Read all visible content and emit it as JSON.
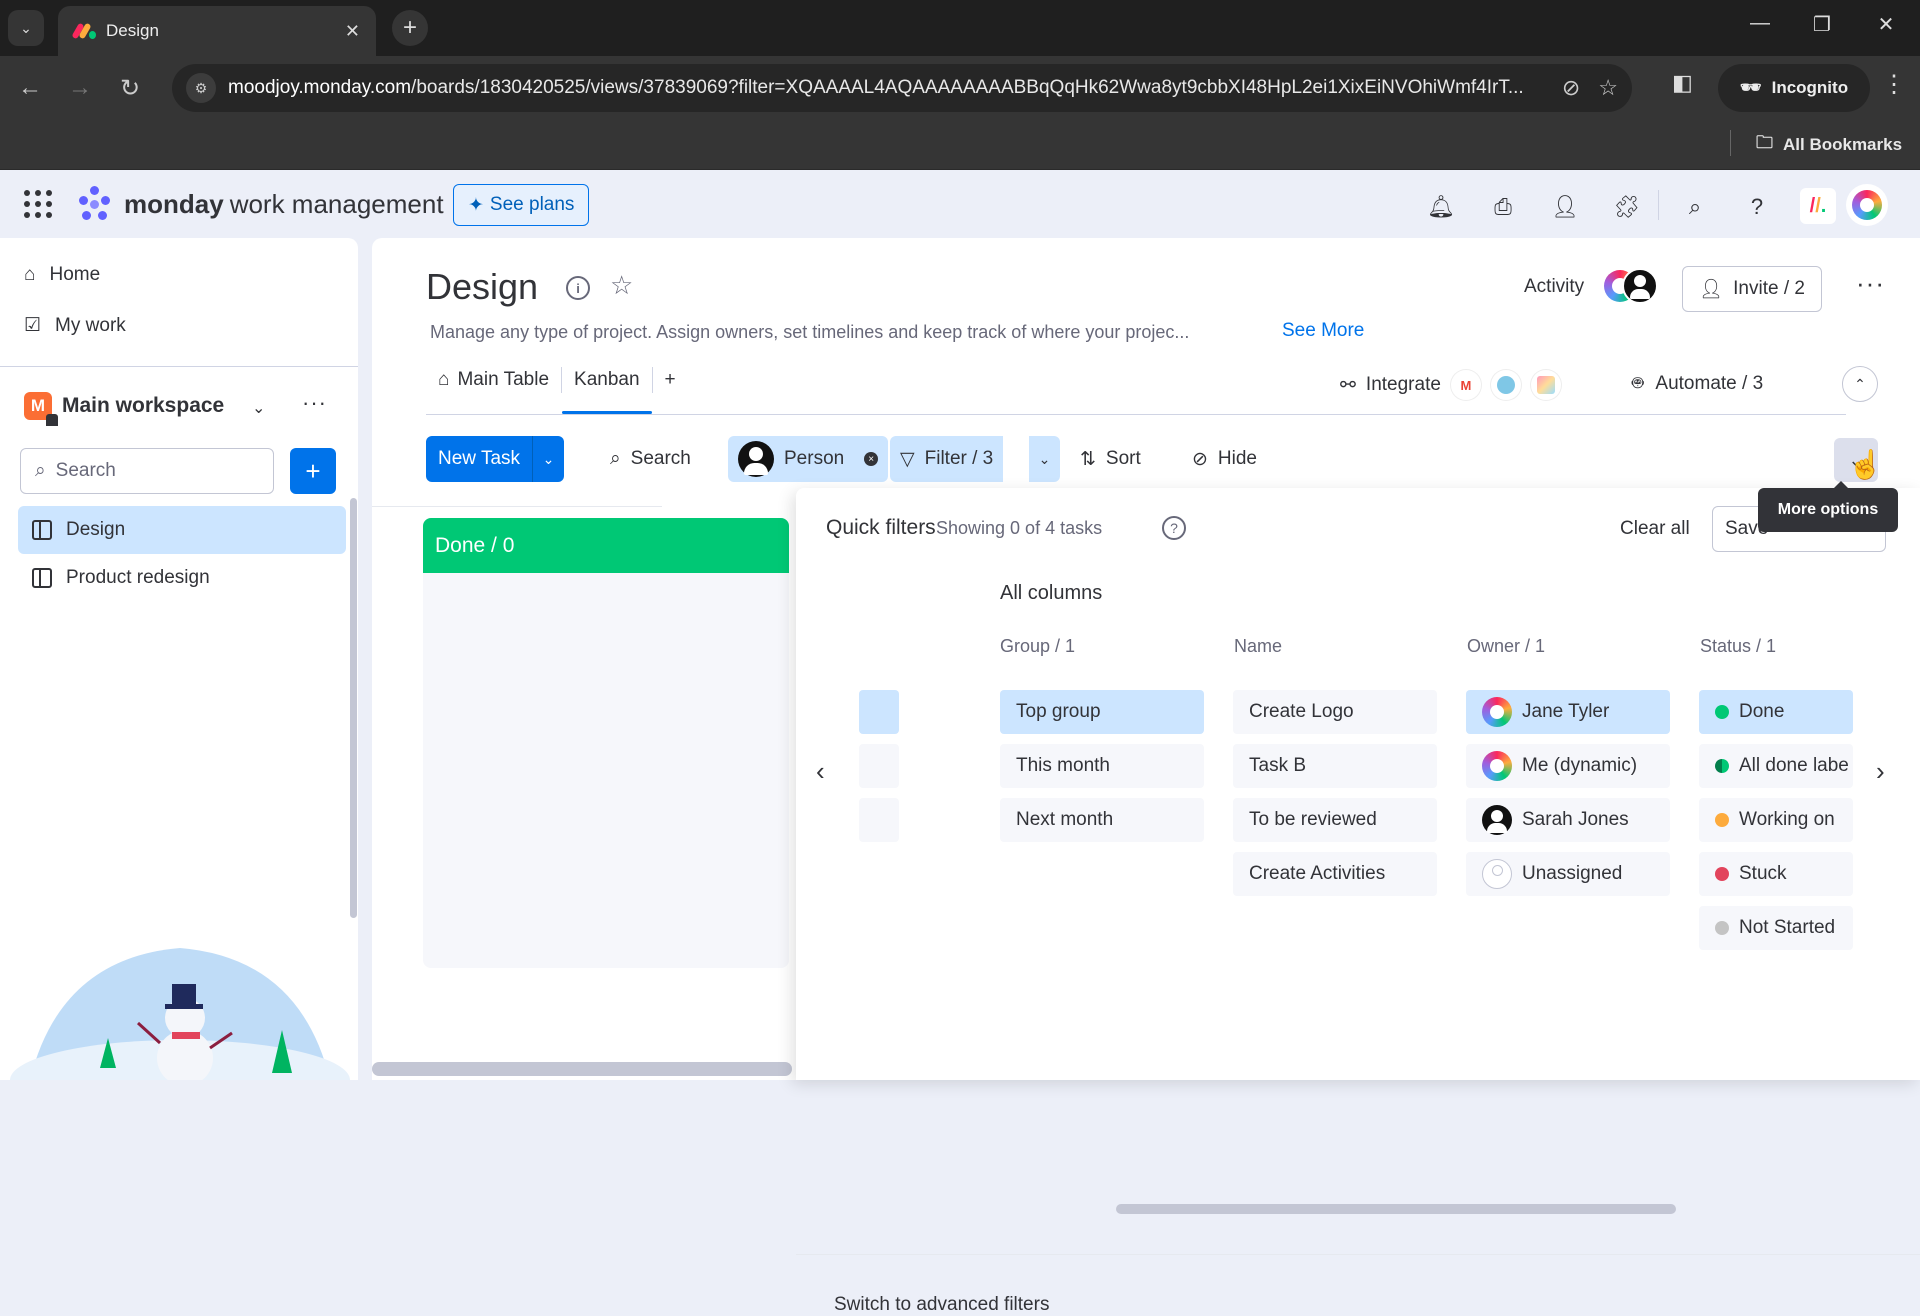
{
  "browser": {
    "tab_title": "Design",
    "url_host": "moodjoy.monday.com",
    "url_path": "/boards/1830420525/views/37839069?filter=XQAAAAL4AQAAAAAAAABBqQqHk62Wwa8yt9cbbXI48HpL2ei1XixEiNVOhiWmf4IrT...",
    "profile_label": "Incognito",
    "bookmarks_label": "All Bookmarks"
  },
  "header": {
    "brand_bold": "monday",
    "brand_rest": "work management",
    "see_plans": "See plans"
  },
  "sidebar": {
    "home": "Home",
    "my_work": "My work",
    "workspace": "Main workspace",
    "workspace_initial": "M",
    "search_placeholder": "Search",
    "boards": [
      {
        "label": "Design",
        "active": true
      },
      {
        "label": "Product redesign",
        "active": false
      }
    ]
  },
  "board": {
    "title": "Design",
    "description": "Manage any type of project. Assign owners, set timelines and keep track of where your projec...",
    "see_more": "See More",
    "activity": "Activity",
    "invite": "Invite / 2",
    "views": [
      {
        "label": "Main Table"
      },
      {
        "label": "Kanban",
        "active": true
      }
    ],
    "add_view": "+",
    "integrate": "Integrate",
    "automate": "Automate / 3"
  },
  "actions": {
    "new_task": "New Task",
    "search": "Search",
    "person": "Person",
    "filter": "Filter / 3",
    "sort": "Sort",
    "hide": "Hide",
    "more_options_tooltip": "More options"
  },
  "kanban": {
    "column_label": "Done / 0",
    "column_color": "#00c875"
  },
  "quick_filters": {
    "title": "Quick filters",
    "showing": "Showing 0 of 4 tasks",
    "clear_all": "Clear all",
    "save": "Save",
    "all_columns": "All columns",
    "switch_advanced": "Switch to advanced filters",
    "columns": {
      "group": {
        "header": "Group / 1",
        "items": [
          {
            "label": "Top group",
            "selected": true
          },
          {
            "label": "This month",
            "selected": false
          },
          {
            "label": "Next month",
            "selected": false
          }
        ]
      },
      "name": {
        "header": "Name",
        "items": [
          {
            "label": "Create Logo"
          },
          {
            "label": "Task B"
          },
          {
            "label": "To be reviewed"
          },
          {
            "label": "Create Activities"
          }
        ]
      },
      "owner": {
        "header": "Owner / 1",
        "items": [
          {
            "label": "Jane Tyler",
            "selected": true,
            "avatar": "rainbow"
          },
          {
            "label": "Me (dynamic)",
            "selected": false,
            "avatar": "rainbow"
          },
          {
            "label": "Sarah Jones",
            "selected": false,
            "avatar": "person"
          },
          {
            "label": "Unassigned",
            "selected": false,
            "avatar": "empty"
          }
        ]
      },
      "status": {
        "header": "Status / 1",
        "items": [
          {
            "label": "Done",
            "selected": true,
            "color": "#00c875"
          },
          {
            "label": "All done labe",
            "selected": false,
            "color": "#00c875"
          },
          {
            "label": "Working on",
            "selected": false,
            "color": "#fdab3d"
          },
          {
            "label": "Stuck",
            "selected": false,
            "color": "#e2445c"
          },
          {
            "label": "Not Started",
            "selected": false,
            "color": "#c4c4c4"
          }
        ]
      }
    }
  }
}
